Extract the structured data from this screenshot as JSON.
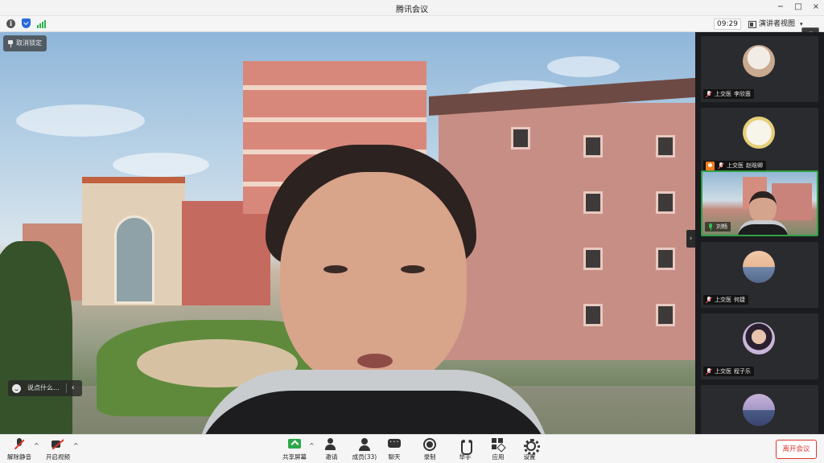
{
  "window": {
    "title": "腾讯会议",
    "controls": [
      "−",
      "□",
      "×"
    ]
  },
  "statusbar": {
    "time": "09:29",
    "view_label": "演讲者视图",
    "view_caret": "▾"
  },
  "main_video": {
    "unpin_label": "取消锁定",
    "chat_placeholder": "说点什么...",
    "chat_collapse": "‹",
    "side_toggle": "›"
  },
  "participants": [
    {
      "org": "上交医",
      "name": "李欣茵",
      "mic": "muted",
      "host": false,
      "avatar": "girl-photo",
      "colors": [
        "#f2ece6",
        "#c9a98f"
      ]
    },
    {
      "org": "上交医",
      "name": "赵晗卿",
      "mic": "muted",
      "host": true,
      "avatar": "cartoon",
      "colors": [
        "#f7f4ea",
        "#e6cf7a"
      ]
    },
    {
      "org": "",
      "name": "刘畅",
      "mic": "on",
      "host": false,
      "avatar": "live-video",
      "active": true
    },
    {
      "org": "上交医",
      "name": "何捷",
      "mic": "muted",
      "host": false,
      "avatar": "sunset",
      "colors": [
        "#f0c8a8",
        "#6f86a8"
      ]
    },
    {
      "org": "上交医",
      "name": "程子乐",
      "mic": "muted",
      "host": false,
      "avatar": "girl-portrait",
      "colors": [
        "#c9b7d9",
        "#2a2030"
      ]
    },
    {
      "org": "",
      "name": "",
      "mic": "",
      "host": false,
      "avatar": "dusk",
      "colors": [
        "#c7b3d8",
        "#4a5a86"
      ]
    }
  ],
  "toolbar": {
    "unmute_label": "解除静音",
    "start_video_label": "开启视频",
    "share_label": "共享屏幕",
    "invite_label": "邀请",
    "members_label": "成员(33)",
    "chat_label": "聊天",
    "record_label": "录制",
    "raise_hand_label": "举手",
    "apps_label": "应用",
    "settings_label": "设置",
    "leave_label": "离开会议",
    "caret": "^"
  },
  "colors": {
    "accent_green": "#2ea043",
    "leave_red": "#e0342c",
    "host_orange": "#f07b1a",
    "shield_blue": "#2a6ad8"
  }
}
